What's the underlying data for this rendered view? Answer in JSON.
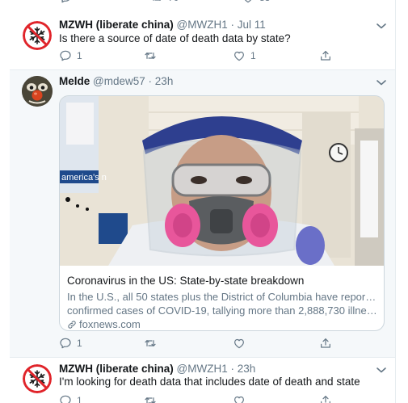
{
  "tweets": [
    {
      "display_name": "MZWH (liberate china)",
      "handle": "@MWZH1",
      "separator": "·",
      "time": "Jul 11",
      "text": "Is there a source of date of death data by state?",
      "counts": {
        "reply": "1",
        "retweet": "",
        "like": "1"
      }
    },
    {
      "display_name": "Melde",
      "handle": "@mdew57",
      "separator": "·",
      "time": "23h",
      "card": {
        "title": "Coronavirus in the US: State-by-state breakdown",
        "description_line1": "In the U.S., all 50 states plus the District of Columbia have reported",
        "description_line2": "confirmed cases of COVID-19, tallying more than 2,888,730 illnesse...",
        "domain": "foxnews.com",
        "image_sign_text": "america's n"
      },
      "counts": {
        "reply": "1",
        "retweet": "",
        "like": ""
      }
    },
    {
      "display_name": "MZWH (liberate china)",
      "handle": "@MWZH1",
      "separator": "·",
      "time": "23h",
      "text": "I'm looking for death data that includes date of death and state",
      "counts": {
        "reply": "1",
        "retweet": "",
        "like": ""
      }
    }
  ],
  "top_partial_counts": {
    "retweet": "70",
    "like": "83"
  },
  "colors": {
    "name": "#14171a",
    "meta": "#657786",
    "highlight_bg": "#f5f8fa",
    "divider": "#e6ecf0",
    "avatar_red": "#e0242a"
  },
  "icons": [
    "reply-icon",
    "retweet-icon",
    "like-icon",
    "share-icon",
    "chevron-down-icon",
    "link-icon"
  ]
}
